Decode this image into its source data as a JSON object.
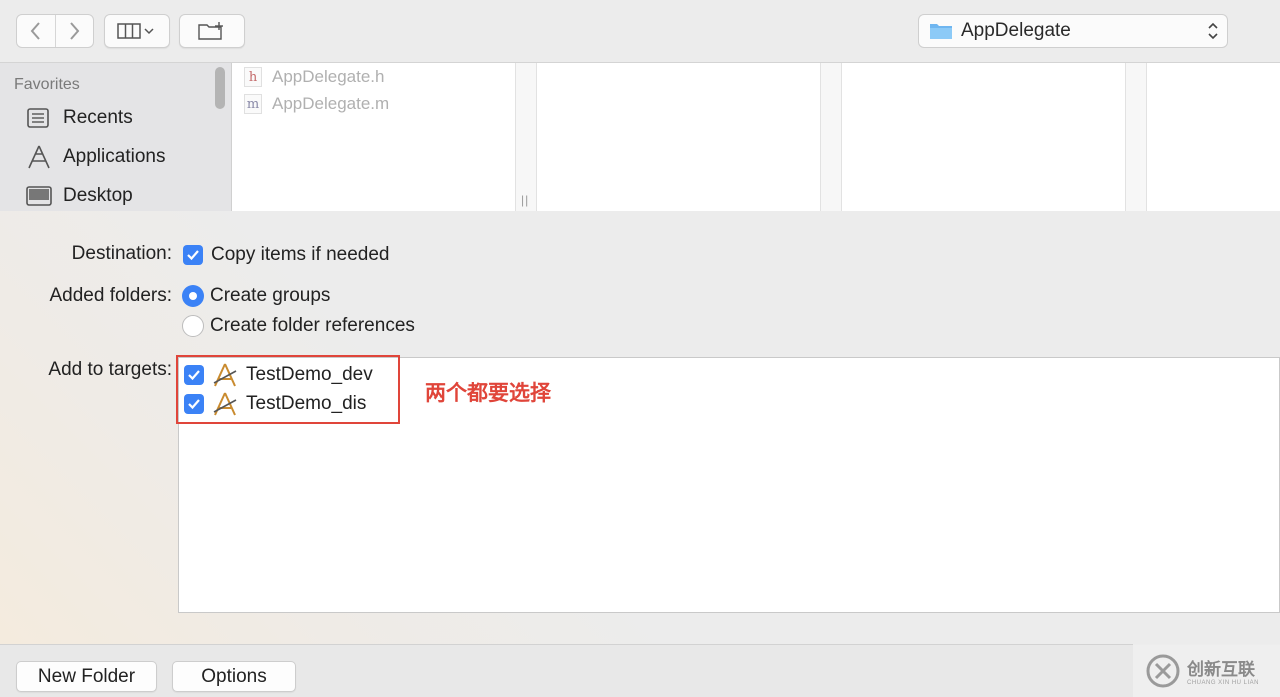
{
  "toolbar": {
    "back_icon": "chevron-left-icon",
    "forward_icon": "chevron-right-icon",
    "view_icon": "column-view-icon",
    "new_folder_icon": "new-folder-icon",
    "path_label": "AppDelegate"
  },
  "sidebar": {
    "heading": "Favorites",
    "items": [
      {
        "label": "Recents",
        "icon": "recents-icon"
      },
      {
        "label": "Applications",
        "icon": "applications-icon"
      },
      {
        "label": "Desktop",
        "icon": "desktop-icon"
      }
    ]
  },
  "browser": {
    "files": [
      {
        "badge": "h",
        "label": "AppDelegate.h"
      },
      {
        "badge": "m",
        "label": "AppDelegate.m"
      }
    ],
    "grip": "||"
  },
  "options": {
    "destination_label": "Destination:",
    "copy_items_label": "Copy items if needed",
    "added_folders_label": "Added folders:",
    "create_groups_label": "Create groups",
    "create_folder_refs_label": "Create folder references",
    "add_to_targets_label": "Add to targets:",
    "targets": [
      {
        "label": "TestDemo_dev",
        "checked": true
      },
      {
        "label": "TestDemo_dis",
        "checked": true
      }
    ],
    "annotation": "两个都要选择"
  },
  "bottom": {
    "new_folder_label": "New Folder",
    "options_label": "Options"
  },
  "watermark": {
    "cn": "创新互联",
    "en": "CHUANG XIN HU LIAN"
  },
  "colors": {
    "accent": "#3b82f6",
    "annotation": "#e0453a"
  }
}
